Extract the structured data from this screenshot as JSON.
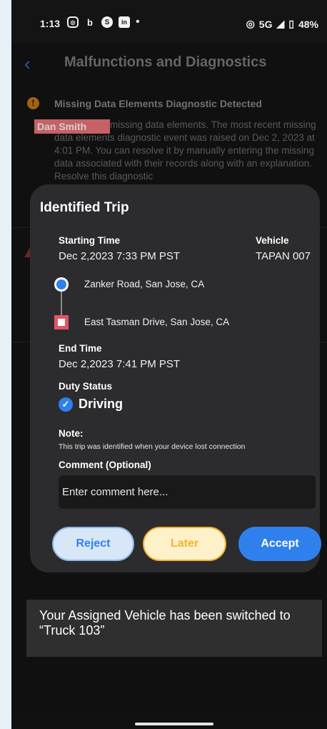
{
  "status_bar": {
    "time": "1:13",
    "network": "5G",
    "battery": "48%"
  },
  "background": {
    "title": "Malfunctions and Diagnostics",
    "diagnostic_title": "Missing Data Elements Diagnostic Detected",
    "diagnostic_body": "ent record is missing data elements. The most recent missing data elements diagnostic event was raised on Dec 2, 2023 at 4:01 PM. You can resolve it by manually entering the missing data associated with their records along with an explanation. Resolve this diagnostic",
    "redaction_label": "Dan Smith"
  },
  "trip_dialog": {
    "title": "Identified Trip",
    "starting_time_label": "Starting Time",
    "starting_time": "Dec 2,2023 7:33 PM PST",
    "vehicle_label": "Vehicle",
    "vehicle": "TAPAN 007",
    "route_start": "Zanker Road, San Jose, CA",
    "route_end": "East Tasman Drive, San Jose, CA",
    "end_time_label": "End Time",
    "end_time": "Dec 2,2023 7:41 PM PST",
    "duty_status_label": "Duty Status",
    "duty_status": "Driving",
    "note_label": "Note:",
    "note": "This trip was identified when your device lost connection",
    "comment_label": "Comment (Optional)",
    "comment_placeholder": "Enter comment here...",
    "reject_label": "Reject",
    "later_label": "Later",
    "accept_label": "Accept"
  },
  "toast": {
    "message": "Your Assigned Vehicle has been switched to “Truck 103”"
  },
  "colors": {
    "accent": "#2f80ed",
    "later": "#f2b233",
    "route_end": "#e25563",
    "warning": "#c67a18"
  }
}
